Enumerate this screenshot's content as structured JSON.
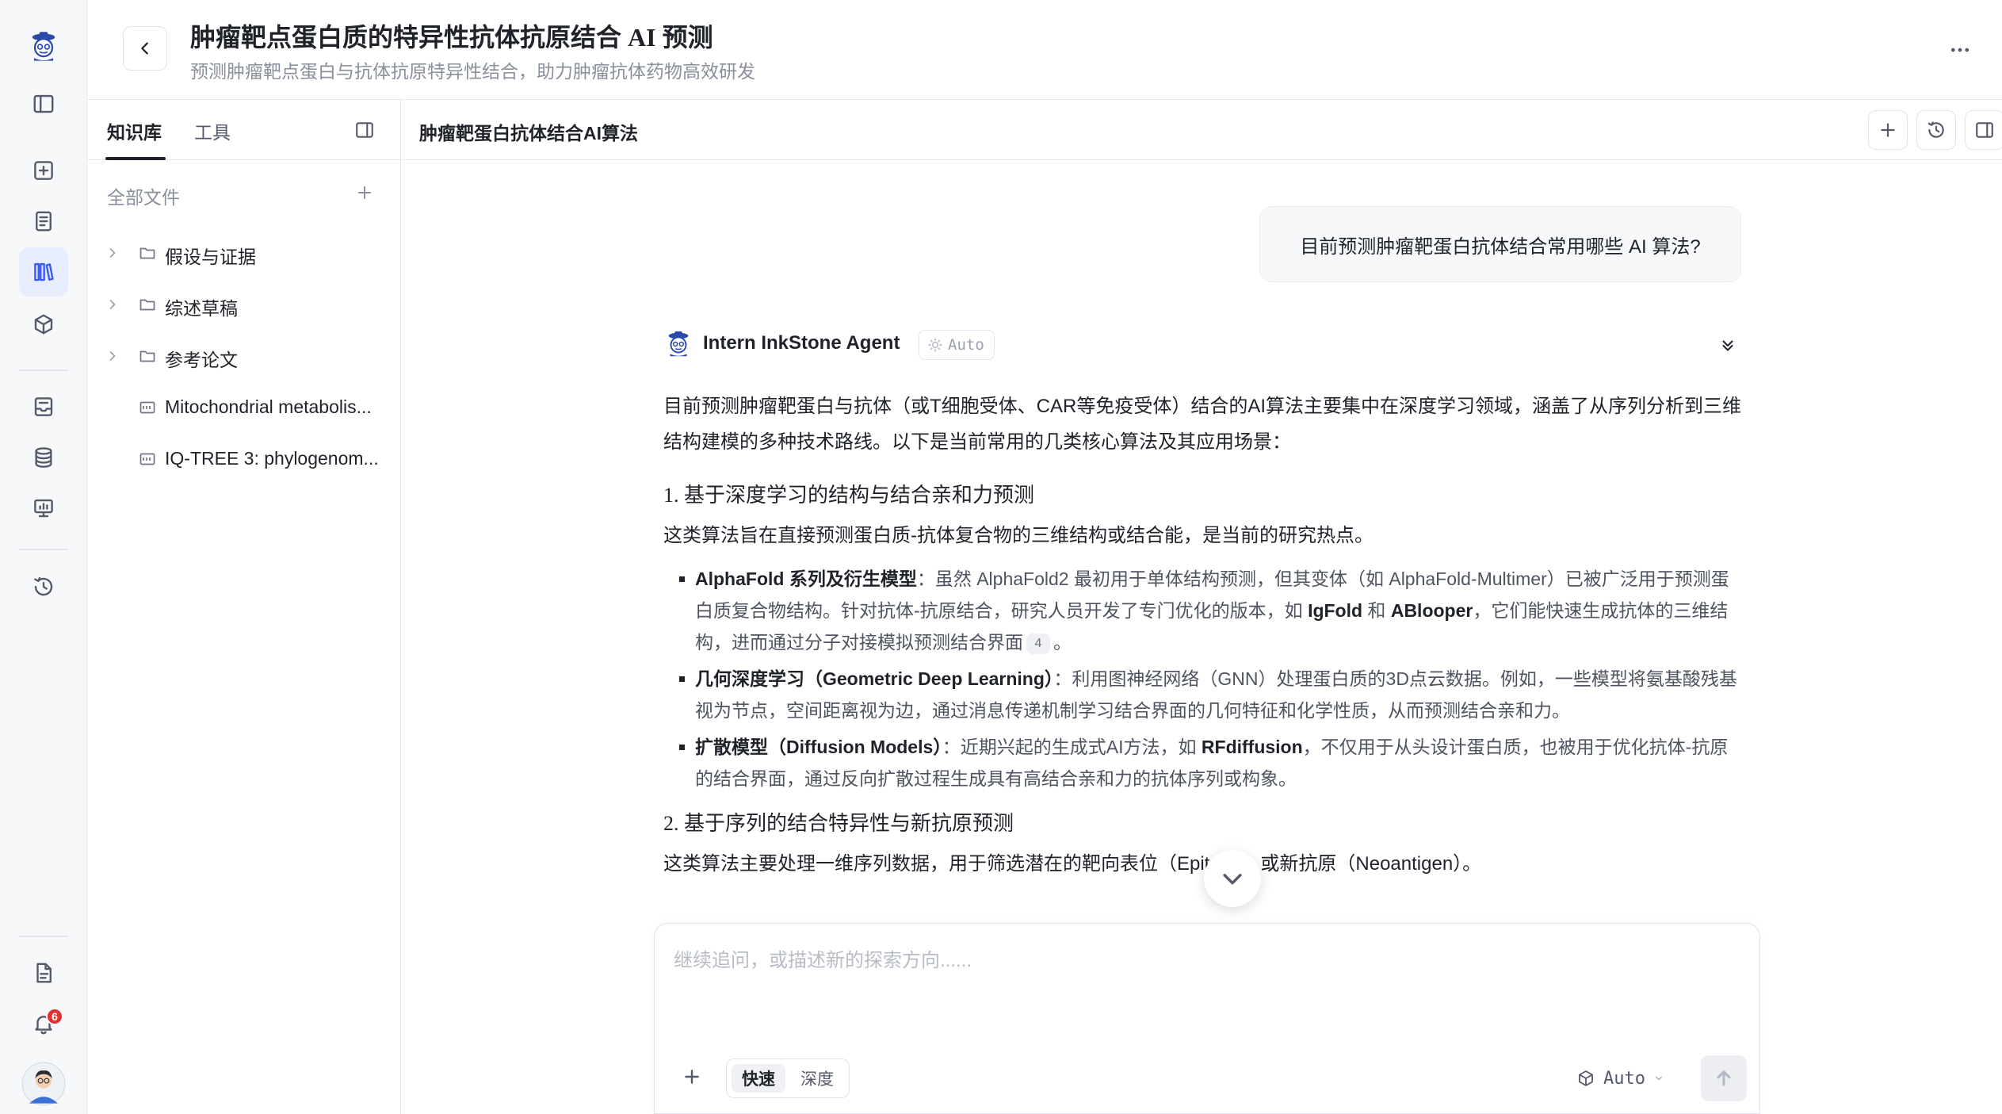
{
  "header": {
    "title": "肿瘤靶点蛋白质的特异性抗体抗原结合 AI 预测",
    "subtitle": "预测肿瘤靶点蛋白与抗体抗原特异性结合，助力肿瘤抗体药物高效研发"
  },
  "rail": {
    "notification_count": "6"
  },
  "panel": {
    "tabs": [
      {
        "label": "知识库",
        "active": true
      },
      {
        "label": "工具",
        "active": false
      }
    ],
    "all_files_label": "全部文件",
    "tree": [
      {
        "type": "folder",
        "label": "假设与证据"
      },
      {
        "type": "folder",
        "label": "综述草稿"
      },
      {
        "type": "folder",
        "label": "参考论文"
      },
      {
        "type": "pdf",
        "label": "Mitochondrial metabolis..."
      },
      {
        "type": "pdf",
        "label": "IQ-TREE 3: phylogenom..."
      }
    ]
  },
  "chat": {
    "title": "肿瘤靶蛋白抗体结合AI算法",
    "user_message": "目前预测肿瘤靶蛋白抗体结合常用哪些 AI 算法?",
    "agent": {
      "name": "Intern InkStone Agent",
      "mode": "Auto"
    },
    "answer": {
      "intro": "目前预测肿瘤靶蛋白与抗体（或T细胞受体、CAR等免疫受体）结合的AI算法主要集中在深度学习领域，涵盖了从序列分析到三维结构建模的多种技术路线。以下是当前常用的几类核心算法及其应用场景：",
      "section1": {
        "heading": "1. 基于深度学习的结构与结合亲和力预测",
        "body": "这类算法旨在直接预测蛋白质-抗体复合物的三维结构或结合能，是当前的研究热点。",
        "bullets": [
          {
            "term": "AlphaFold 系列及衍生模型",
            "text_a": "：虽然 AlphaFold2 最初用于单体结构预测，但其变体（如 AlphaFold-Multimer）已被广泛用于预测蛋白质复合物结构。针对抗体-抗原结合，研究人员开发了专门优化的版本，如 ",
            "term2": "IgFold",
            "text_b": " 和 ",
            "term3": "ABlooper",
            "text_c": "，它们能快速生成抗体的三维结构，进而通过分子对接模拟预测结合界面",
            "cite": "4",
            "text_d": "。"
          },
          {
            "term": "几何深度学习（Geometric Deep Learning）",
            "text_a": "：利用图神经网络（GNN）处理蛋白质的3D点云数据。例如，一些模型将氨基酸残基视为节点，空间距离视为边，通过消息传递机制学习结合界面的几何特征和化学性质，从而预测结合亲和力。"
          },
          {
            "term": "扩散模型（Diffusion Models）",
            "text_a": "：近期兴起的生成式AI方法，如 ",
            "term2": "RFdiffusion",
            "text_b": "，不仅用于从头设计蛋白质，也被用于优化抗体-抗原的结合界面，通过反向扩散过程生成具有高结合亲和力的抗体序列或构象。"
          }
        ]
      },
      "section2": {
        "heading": "2. 基于序列的结合特异性与新抗原预测",
        "body": "这类算法主要处理一维序列数据，用于筛选潜在的靶向表位（Epitope）或新抗原（Neoantigen）。"
      }
    },
    "composer": {
      "placeholder": "继续追问，或描述新的探索方向......",
      "speed_fast": "快速",
      "speed_deep": "深度",
      "model": "Auto"
    }
  }
}
